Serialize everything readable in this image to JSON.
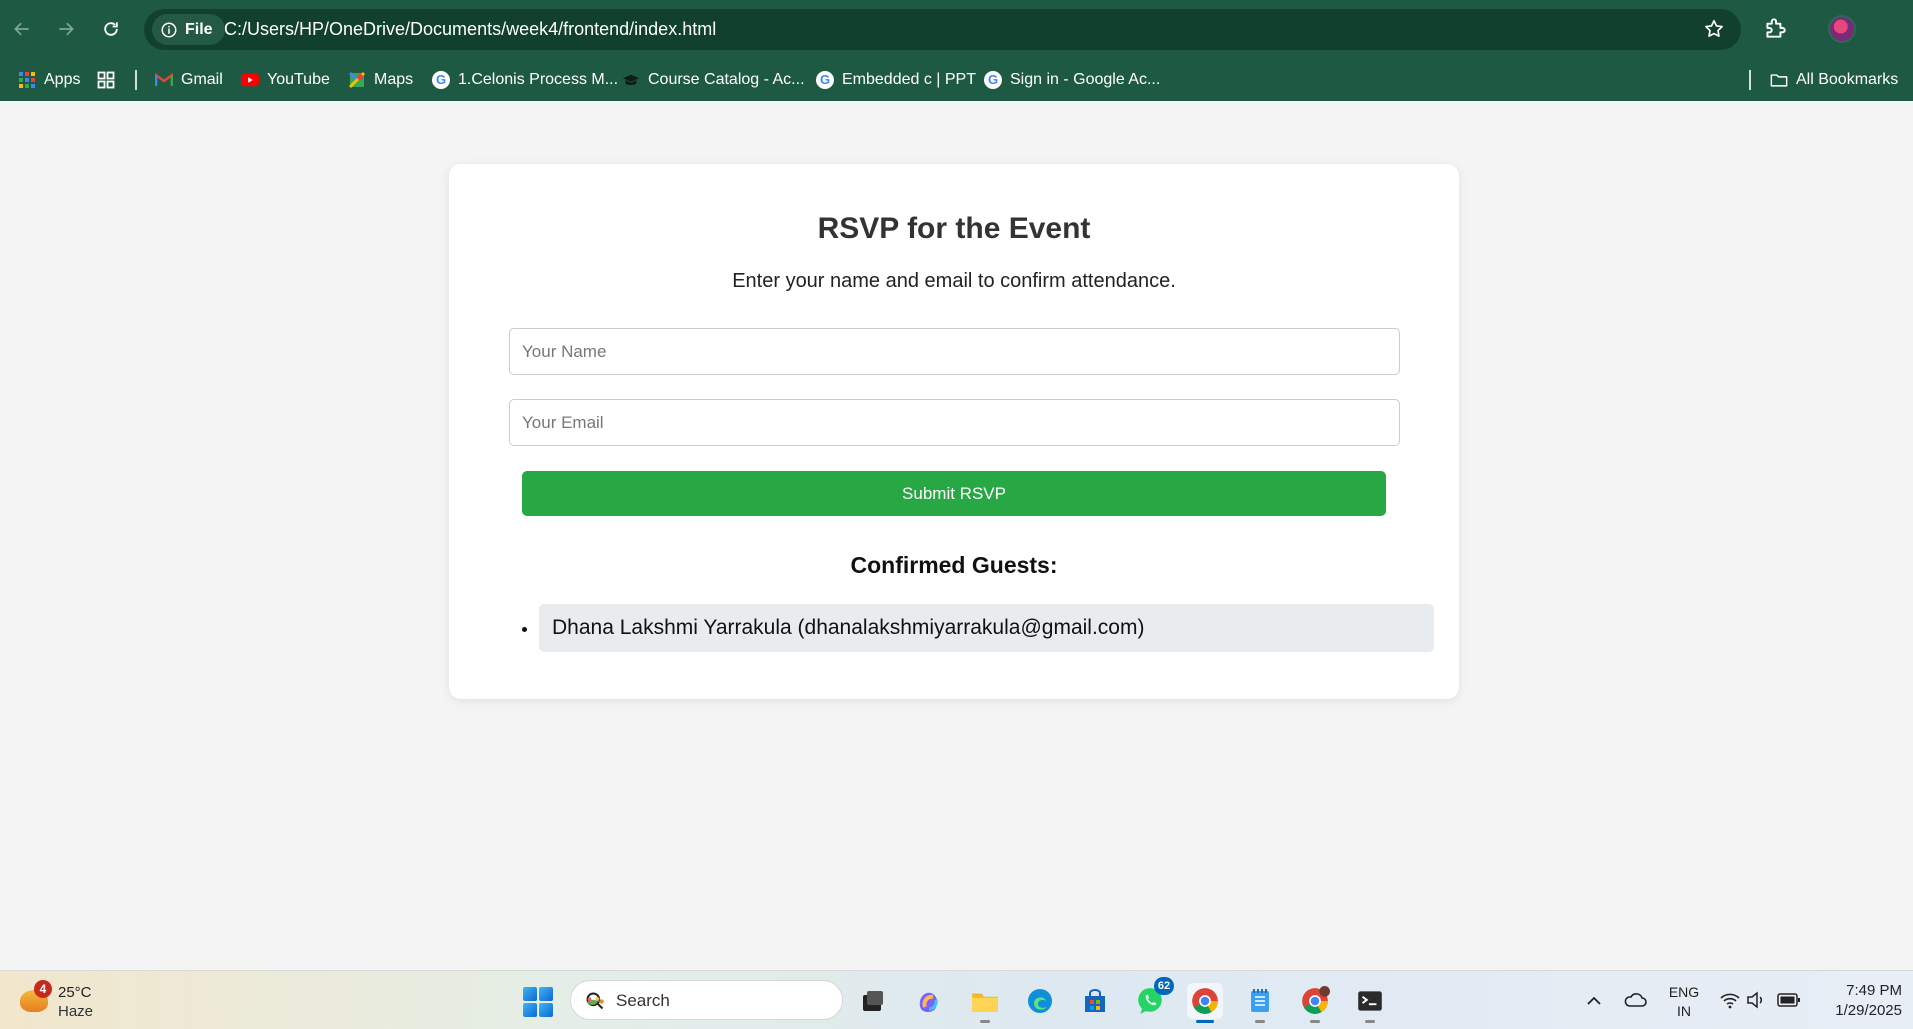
{
  "browser": {
    "site_info_label": "File",
    "url": "C:/Users/HP/OneDrive/Documents/week4/frontend/index.html"
  },
  "bookmarks": {
    "apps_label": "Apps",
    "items": [
      {
        "label": "Gmail",
        "icon": "gmail-icon"
      },
      {
        "label": "YouTube",
        "icon": "youtube-icon"
      },
      {
        "label": "Maps",
        "icon": "maps-icon"
      },
      {
        "label": "1.Celonis Process M...",
        "icon": "google-icon"
      },
      {
        "label": "Course Catalog - Ac...",
        "icon": "graduation-cap-icon"
      },
      {
        "label": "Embedded c | PPT",
        "icon": "google-icon"
      },
      {
        "label": "Sign in - Google Ac...",
        "icon": "google-icon"
      }
    ],
    "all_bookmarks_label": "All Bookmarks"
  },
  "rsvp": {
    "title": "RSVP for the Event",
    "subtitle": "Enter your name and email to confirm attendance.",
    "name_placeholder": "Your Name",
    "email_placeholder": "Your Email",
    "submit_label": "Submit RSVP",
    "guests_heading": "Confirmed Guests:",
    "guests": [
      "Dhana Lakshmi Yarrakula (dhanalakshmiyarrakula@gmail.com)"
    ]
  },
  "taskbar": {
    "weather_badge": "4",
    "temperature": "25°C",
    "condition": "Haze",
    "search_label": "Search",
    "whatsapp_badge": "62",
    "lang_line1": "ENG",
    "lang_line2": "IN",
    "time": "7:49 PM",
    "date": "1/29/2025"
  },
  "colors": {
    "chrome": "#1e5a43",
    "submit": "#28a745",
    "guest_bg": "#e9ecef"
  }
}
